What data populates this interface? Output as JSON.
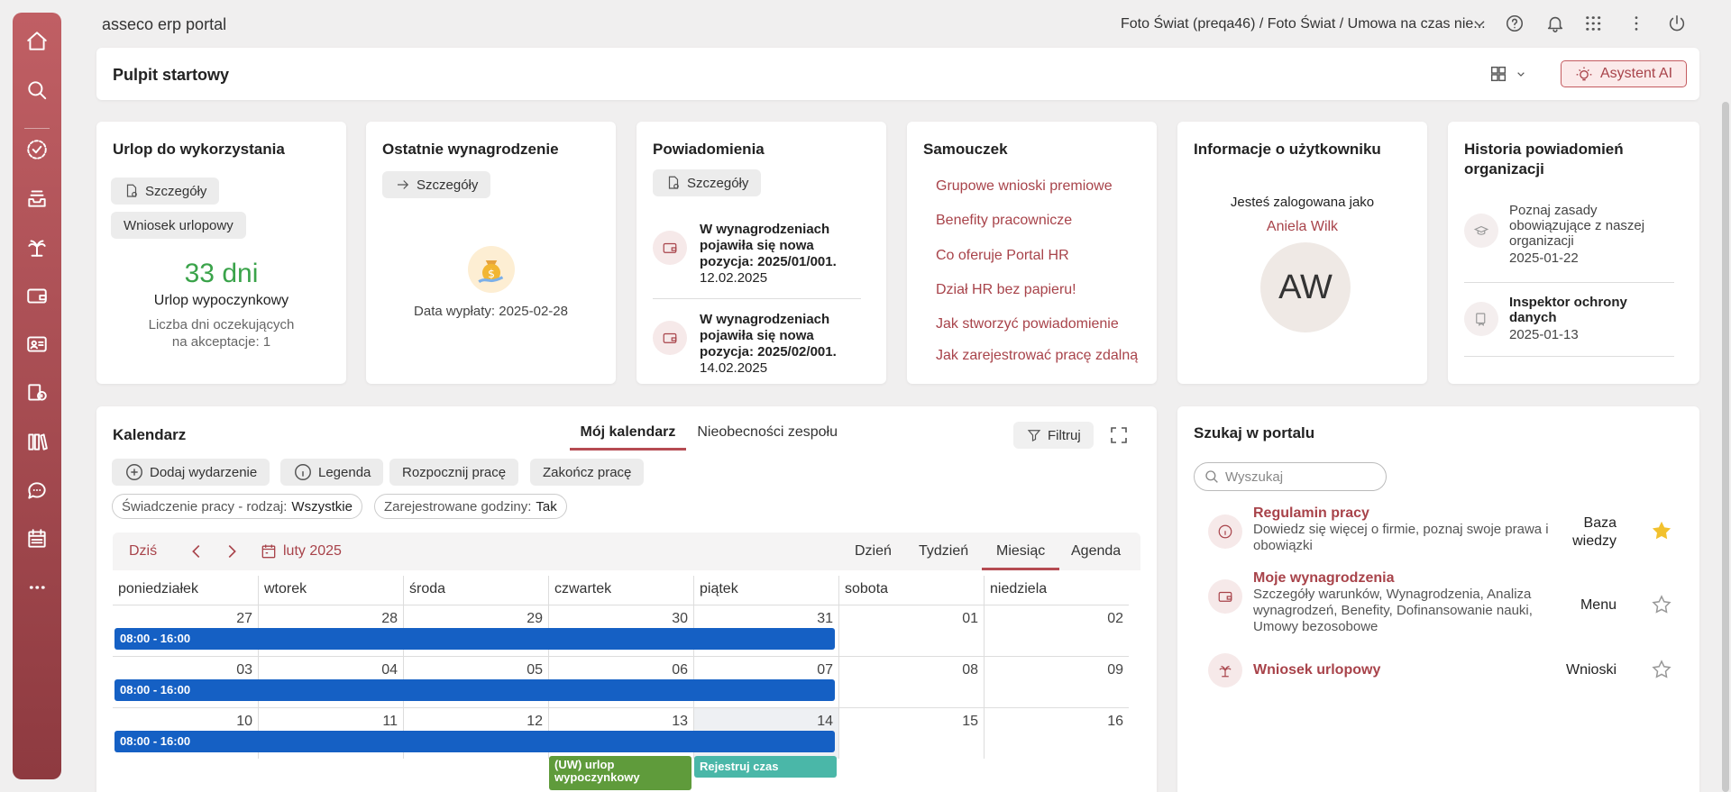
{
  "app": {
    "title": "asseco erp portal",
    "breadcrumb": "Foto Świat (preqa46) / Foto Świat / Umowa na czas nie..."
  },
  "header": {
    "title": "Pulpit startowy",
    "ai_label": "Asystent AI"
  },
  "leave": {
    "title": "Urlop do wykorzystania",
    "details": "Szczegóły",
    "request": "Wniosek urlopowy",
    "days": "33 dni",
    "type": "Urlop wypoczynkowy",
    "pending_1": "Liczba dni oczekujących",
    "pending_2": "na akceptacje: 1"
  },
  "salary": {
    "title": "Ostatnie wynagrodzenie",
    "details": "Szczegóły",
    "payout": "Data wypłaty: 2025-02-28"
  },
  "notifications": {
    "title": "Powiadomienia",
    "details": "Szczegóły",
    "items": [
      {
        "l1": "W wynagrodzeniach",
        "l2": "pojawiła się nowa",
        "l3": "pozycja: 2025/01/001.",
        "l4": "12.02.2025"
      },
      {
        "l1": "W wynagrodzeniach",
        "l2": "pojawiła się nowa",
        "l3": "pozycja: 2025/02/001.",
        "l4": "14.02.2025"
      }
    ]
  },
  "tutorial": {
    "title": "Samouczek",
    "links": [
      "Grupowe wnioski premiowe",
      "Benefity pracownicze",
      "Co oferuje Portal HR",
      "Dział HR bez papieru!",
      "Jak stworzyć powiadomienie",
      "Jak zarejestrować pracę zdalną"
    ]
  },
  "user": {
    "title": "Informacje o użytkowniku",
    "logged_as": "Jesteś zalogowana jako",
    "name": "Aniela Wilk",
    "initials": "AW"
  },
  "history": {
    "title_1": "Historia powiadomień",
    "title_2": "organizacji",
    "items": [
      {
        "l1": "Poznaj zasady",
        "l2": "obowiązujące z naszej",
        "l3": "organizacji",
        "date": "2025-01-22"
      },
      {
        "l1": "Inspektor ochrony",
        "l2": "danych",
        "date": "2025-01-13"
      }
    ]
  },
  "calendar": {
    "title": "Kalendarz",
    "tab_mine": "Mój kalendarz",
    "tab_team": "Nieobecności zespołu",
    "filter": "Filtruj",
    "add_event": "Dodaj wydarzenie",
    "legend": "Legenda",
    "start_work": "Rozpocznij pracę",
    "end_work": "Zakończ pracę",
    "chip1_label": "Świadczenie pracy - rodzaj:",
    "chip1_value": "Wszystkie",
    "chip2_label": "Zarejestrowane godziny:",
    "chip2_value": "Tak",
    "today": "Dziś",
    "month_label": "luty 2025",
    "views": [
      "Dzień",
      "Tydzień",
      "Miesiąc",
      "Agenda"
    ],
    "days": [
      "poniedziałek",
      "wtorek",
      "środa",
      "czwartek",
      "piątek",
      "sobota",
      "niedziela"
    ],
    "weeks": [
      [
        "27",
        "28",
        "29",
        "30",
        "31",
        "01",
        "02"
      ],
      [
        "03",
        "04",
        "05",
        "06",
        "07",
        "08",
        "09"
      ],
      [
        "10",
        "11",
        "12",
        "13",
        "14",
        "15",
        "16"
      ]
    ],
    "work_hours": "08:00 - 16:00",
    "leave_event_1": "(UW) urlop",
    "leave_event_2": "wypoczynkowy",
    "register_event": "Rejestruj czas"
  },
  "search": {
    "title": "Szukaj w portalu",
    "placeholder": "Wyszukaj",
    "results": [
      {
        "title": "Regulamin pracy",
        "desc1": "Dowiedz się więcej o firmie, poznaj swoje prawa i",
        "desc2": "obowiązki",
        "cat1": "Baza",
        "cat2": "wiedzy",
        "favorite": true
      },
      {
        "title": "Moje wynagrodzenia",
        "desc1": "Szczegóły warunków, Wynagrodzenia, Analiza",
        "desc2": "wynagrodzeń, Benefity, Dofinansowanie nauki,",
        "desc3": "Umowy bezosobowe",
        "cat1": "Menu",
        "favorite": false
      },
      {
        "title": "Wniosek urlopowy",
        "cat1": "Wnioski",
        "favorite": false
      }
    ]
  },
  "colors": {
    "accent": "#a8434a",
    "event_blue": "#1560c4",
    "event_green": "#5f9b3b",
    "event_teal": "#4ab7a8",
    "days_green": "#3aa34a"
  }
}
